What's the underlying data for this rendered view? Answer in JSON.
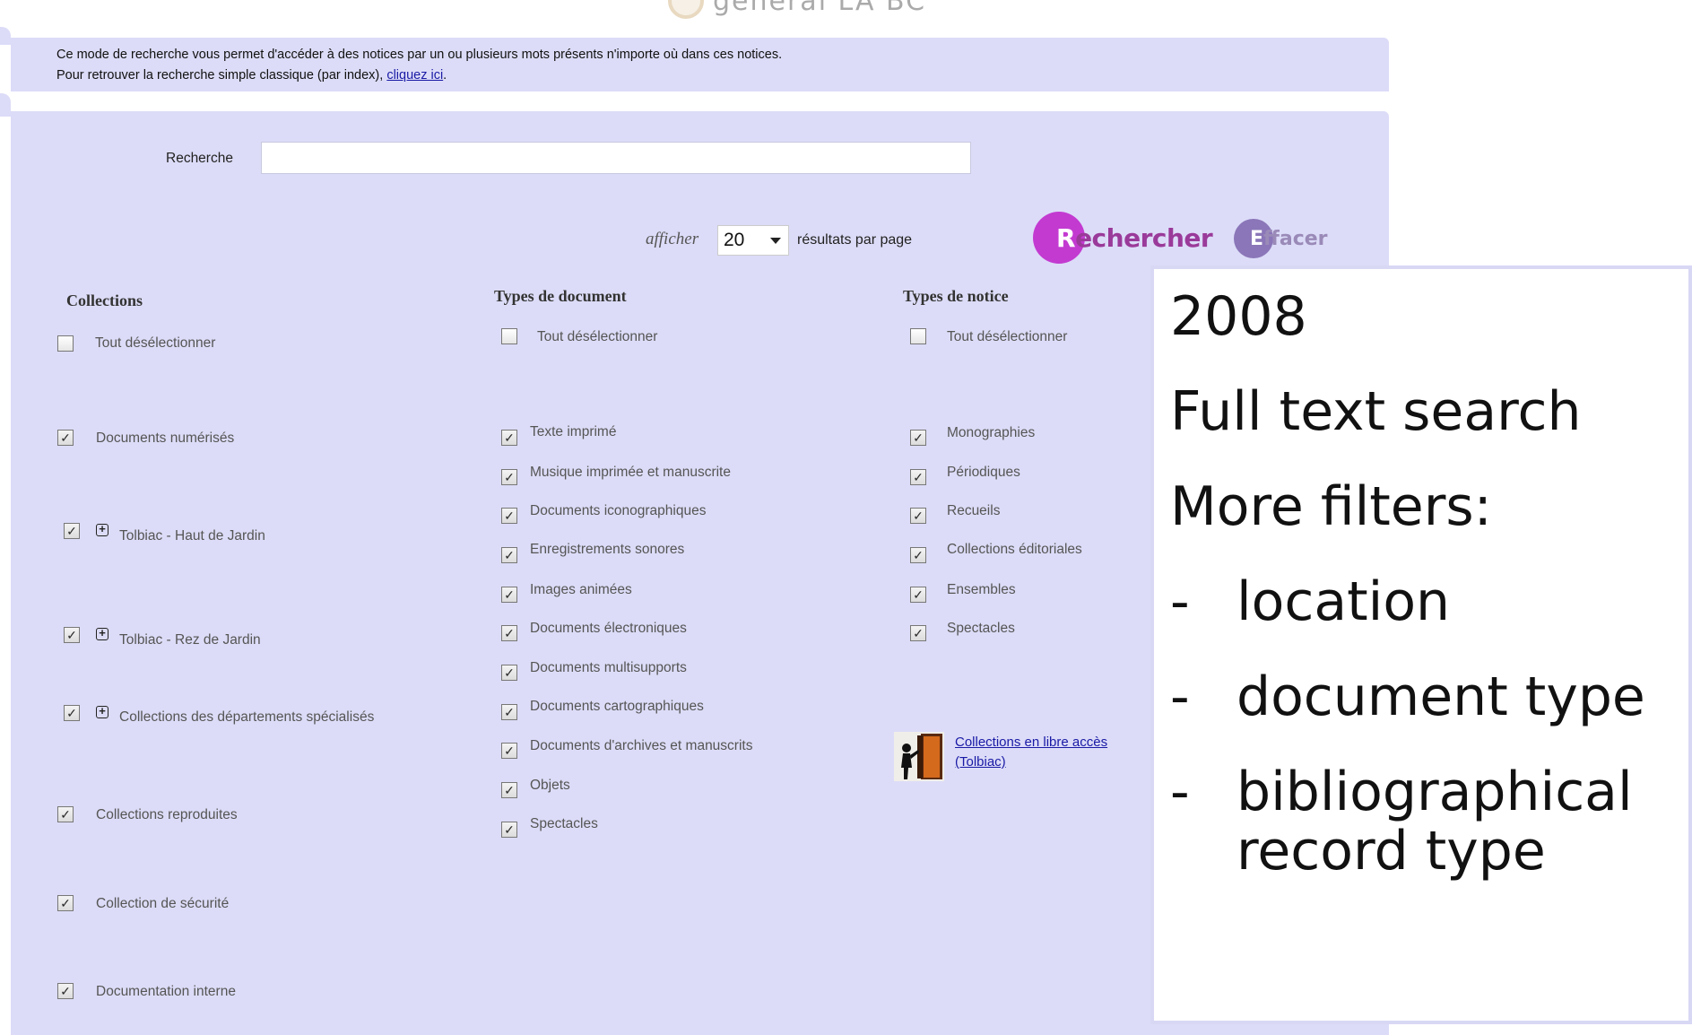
{
  "header": {
    "logo_text": "général LA BC"
  },
  "info": {
    "line1": "Ce mode de recherche vous permet d'accéder à des notices par un ou plusieurs mots présents n'importe où dans ces notices.",
    "line2_prefix": "Pour retrouver la recherche simple classique (par index), ",
    "line2_link": "cliquez ici",
    "line2_suffix": "."
  },
  "search": {
    "label": "Recherche",
    "value": "",
    "afficher_label": "afficher",
    "per_page_value": "20",
    "per_page_suffix": "résultats par page",
    "search_button": {
      "initial": "R",
      "rest": "echercher"
    },
    "clear_button": {
      "initial": "E",
      "rest": "ffacer"
    }
  },
  "collections": {
    "title": "Collections",
    "deselect_all": "Tout désélectionner",
    "items": [
      {
        "label": "Documents numérisés",
        "checked": true,
        "expandable": false
      },
      {
        "label": "Tolbiac - Haut de Jardin",
        "checked": true,
        "expandable": true
      },
      {
        "label": "Tolbiac - Rez de Jardin",
        "checked": true,
        "expandable": true
      },
      {
        "label": "Collections des départements spécialisés",
        "checked": true,
        "expandable": true
      },
      {
        "label": "Collections reproduites",
        "checked": true,
        "expandable": false
      },
      {
        "label": "Collection de sécurité",
        "checked": true,
        "expandable": false
      },
      {
        "label": "Documentation interne",
        "checked": true,
        "expandable": false
      }
    ]
  },
  "doc_types": {
    "title": "Types de document",
    "deselect_all": "Tout désélectionner",
    "items": [
      {
        "label": "Texte imprimé",
        "checked": true
      },
      {
        "label": "Musique imprimée et manuscrite",
        "checked": true
      },
      {
        "label": "Documents iconographiques",
        "checked": true
      },
      {
        "label": "Enregistrements sonores",
        "checked": true
      },
      {
        "label": "Images animées",
        "checked": true
      },
      {
        "label": "Documents électroniques",
        "checked": true
      },
      {
        "label": "Documents multisupports",
        "checked": true
      },
      {
        "label": "Documents cartographiques",
        "checked": true
      },
      {
        "label": "Documents d'archives et manuscrits",
        "checked": true
      },
      {
        "label": "Objets",
        "checked": true
      },
      {
        "label": "Spectacles",
        "checked": true
      }
    ]
  },
  "notice_types": {
    "title": "Types de notice",
    "deselect_all": "Tout désélectionner",
    "items": [
      {
        "label": "Monographies",
        "checked": true
      },
      {
        "label": "Périodiques",
        "checked": true
      },
      {
        "label": "Recueils",
        "checked": true
      },
      {
        "label": "Collections éditoriales",
        "checked": true
      },
      {
        "label": "Ensembles",
        "checked": true
      },
      {
        "label": "Spectacles",
        "checked": true
      }
    ],
    "access_link_line1": "Collections en libre accès",
    "access_link_line2": "(Tolbiac)"
  },
  "overlay": {
    "year": "2008",
    "line1": "Full text search",
    "line2": "More filters:",
    "dash": "-",
    "bullets": [
      "location",
      "document type",
      "bibliographical"
    ],
    "bullet3_cont": "record type"
  },
  "colors": {
    "panel": "#dcdcf8",
    "search_button": "#c33ad1",
    "clear_button": "#8a76b8",
    "link": "#1a1aa6"
  },
  "icons": [
    "checkbox-icon",
    "expand-plus-icon",
    "library-access-icon",
    "dropdown-arrow-icon"
  ]
}
